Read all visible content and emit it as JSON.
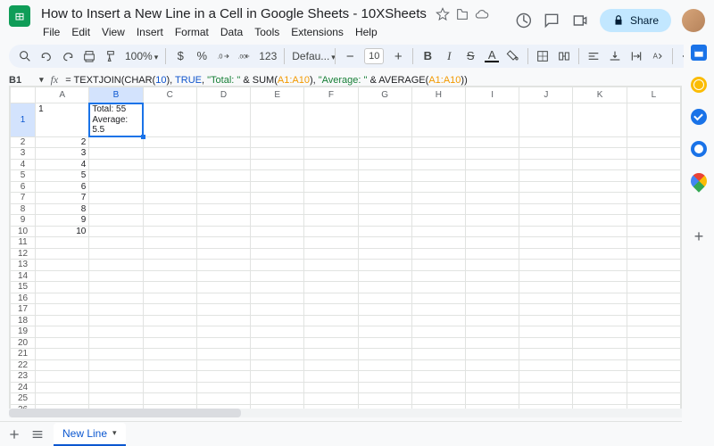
{
  "header": {
    "title": "How to Insert a New Line in a Cell in Google Sheets - 10XSheets",
    "menus": [
      "File",
      "Edit",
      "View",
      "Insert",
      "Format",
      "Data",
      "Tools",
      "Extensions",
      "Help"
    ],
    "share_label": "Share"
  },
  "toolbar": {
    "zoom": "100%",
    "font_name": "Defau...",
    "font_size": "10"
  },
  "formula": {
    "name_box": "B1",
    "raw": "= TEXTJOIN(CHAR(10), TRUE, \"Total: \" & SUM(A1:A10), \"Average: \" & AVERAGE(A1:A10))"
  },
  "grid": {
    "columns": [
      "A",
      "B",
      "C",
      "D",
      "E",
      "F",
      "G",
      "H",
      "I",
      "J",
      "K",
      "L"
    ],
    "rows": 29,
    "selected_col": "B",
    "selected_row": 1,
    "a_values": [
      "1",
      "2",
      "3",
      "4",
      "5",
      "6",
      "7",
      "8",
      "9",
      "10"
    ],
    "b1_value": "Total: 55\nAverage: 5.5"
  },
  "sheets": {
    "active": "New Line"
  },
  "sidepanel": {
    "icons": [
      "calendar",
      "keep",
      "tasks",
      "contacts",
      "maps"
    ]
  }
}
